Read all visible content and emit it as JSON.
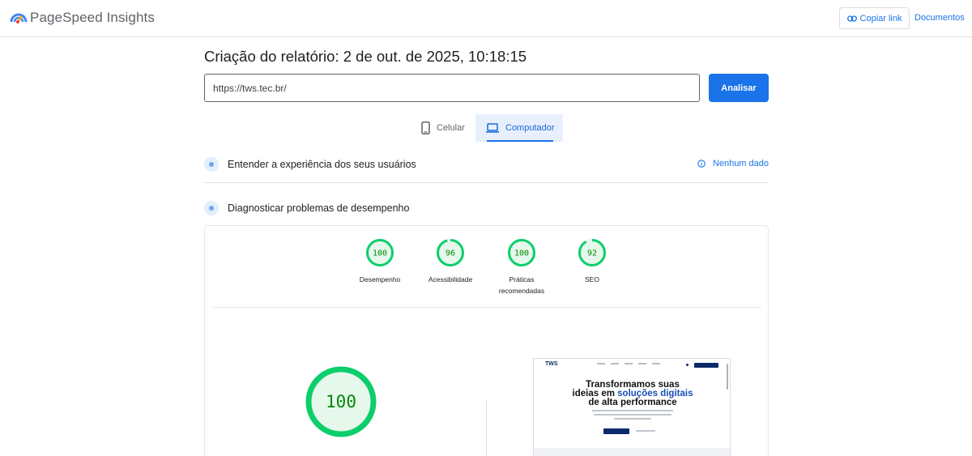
{
  "header": {
    "brand": "PageSpeed Insights",
    "copy_link_label": "Copiar link",
    "docs_label": "Documentos"
  },
  "report": {
    "title": "Criação do relatório: 2 de out. de 2025, 10:18:15",
    "url_value": "https://tws.tec.br/",
    "analyze_label": "Analisar"
  },
  "tabs": [
    {
      "label": "Celular",
      "icon": "phone-icon",
      "selected": false
    },
    {
      "label": "Computador",
      "icon": "laptop-icon",
      "selected": true
    }
  ],
  "sections": {
    "experience": {
      "label": "Entender a experiência dos seus usuários",
      "status": "Nenhum dado"
    },
    "diagnose": {
      "label": "Diagnosticar problemas de desempenho"
    }
  },
  "scores": [
    {
      "value": "100",
      "label_line1": "Desempenho",
      "label_line2": ""
    },
    {
      "value": "96",
      "label_line1": "Acessibilidade",
      "label_line2": ""
    },
    {
      "value": "100",
      "label_line1": "Práticas",
      "label_line2": "recomendadas"
    },
    {
      "value": "92",
      "label_line1": "SEO",
      "label_line2": ""
    }
  ],
  "main_score": {
    "value": "100"
  },
  "preview": {
    "logo": "TWS",
    "headline_line1": "Transformamos suas",
    "headline_line2_a": "ideias em ",
    "headline_line2_b": "soluções digitais",
    "headline_line3": "de alta performance"
  },
  "colors": {
    "accent": "#1a73e8",
    "pass_green": "#0cce6b",
    "pass_text": "#008800",
    "pass_fill": "#e6f7ec"
  }
}
